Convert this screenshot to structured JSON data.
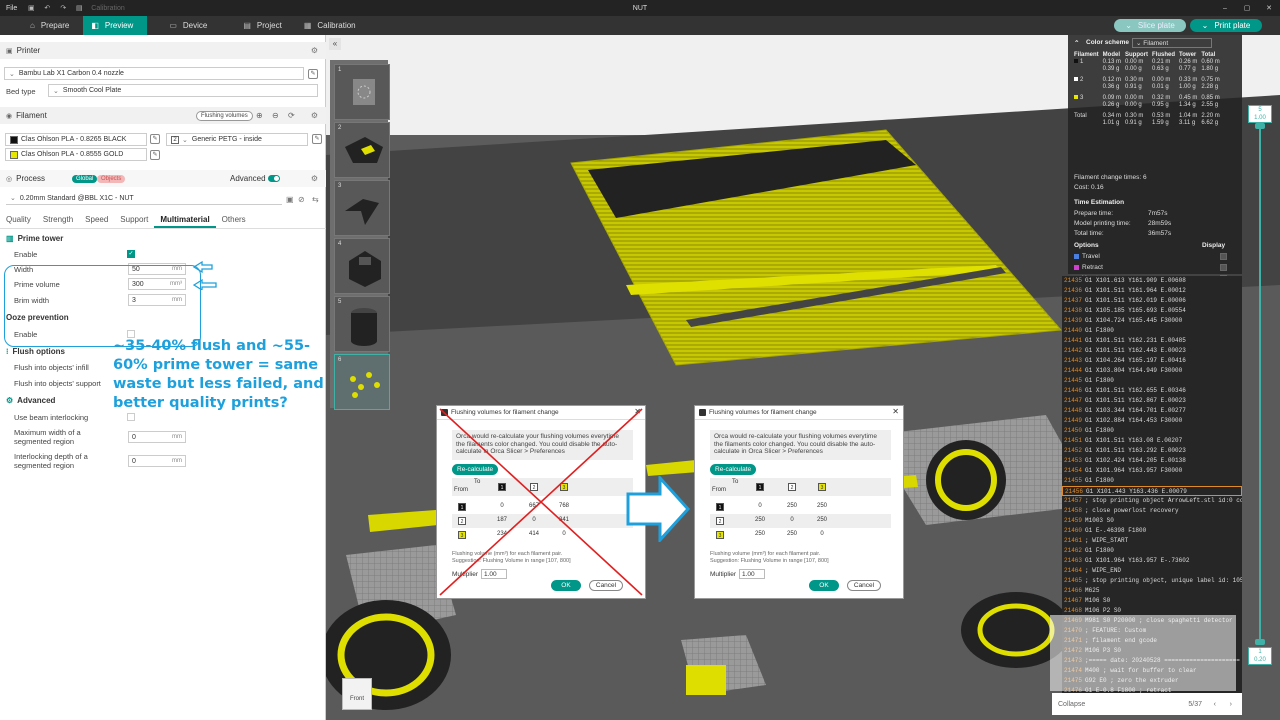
{
  "app": {
    "window_title": "NUT"
  },
  "titlebar": {
    "file": "File",
    "calibration": "Calibration"
  },
  "tabs": [
    {
      "label": "Prepare",
      "icon": "home-icon"
    },
    {
      "label": "Preview",
      "icon": "preview-icon"
    },
    {
      "label": "Device",
      "icon": "device-icon"
    },
    {
      "label": "Project",
      "icon": "project-icon"
    },
    {
      "label": "Calibration",
      "icon": "calibration-icon"
    }
  ],
  "actions": {
    "slice_label": "Slice plate",
    "print_label": "Print plate"
  },
  "printer": {
    "section": "Printer",
    "name": "Bambu Lab X1 Carbon 0.4 nozzle",
    "bed_type_label": "Bed type",
    "bed_type": "Smooth Cool Plate"
  },
  "filament": {
    "section": "Filament",
    "flushing_btn": "Flushing volumes",
    "slots": [
      {
        "num": "1",
        "name": "Clas Ohlson PLA - 0.8265 BLACK",
        "color": "#111111"
      },
      {
        "num": "2",
        "name": "Generic PETG - inside",
        "color": "#ffffff"
      },
      {
        "num": "3",
        "name": "Clas Ohlson PLA - 0.8555 GOLD",
        "color": "#e6e600"
      }
    ]
  },
  "process": {
    "section": "Process",
    "global": "Global",
    "objects": "Objects",
    "advanced": "Advanced",
    "preset": "0.20mm Standard @BBL X1C - NUT",
    "tabs": [
      "Quality",
      "Strength",
      "Speed",
      "Support",
      "Multimaterial",
      "Others"
    ]
  },
  "prime_tower": {
    "title": "Prime tower",
    "enable_label": "Enable",
    "width_label": "Width",
    "width": "50",
    "width_unit": "mm",
    "volume_label": "Prime volume",
    "volume": "300",
    "volume_unit": "mm³",
    "brim_label": "Brim width",
    "brim": "3",
    "brim_unit": "mm"
  },
  "ooze": {
    "title": "Ooze prevention",
    "enable_label": "Enable"
  },
  "flush_opts": {
    "title": "Flush options",
    "infill": "Flush into objects' infill",
    "support": "Flush into objects' support"
  },
  "advanced": {
    "title": "Advanced",
    "beam": "Use beam interlocking",
    "max_w_label": "Maximum width of a segmented region",
    "max_w": "0",
    "max_w_unit": "mm",
    "depth_label": "Interlocking depth of a segmented region",
    "depth": "0",
    "depth_unit": "mm"
  },
  "annotation": "~35-40% flush and ~55-60% prime tower = same waste but less failed, and better quality prints?",
  "objects": [
    {
      "num": "1"
    },
    {
      "num": "2"
    },
    {
      "num": "3"
    },
    {
      "num": "4"
    },
    {
      "num": "5"
    },
    {
      "num": "6"
    }
  ],
  "legend": {
    "color_scheme_label": "Color scheme",
    "color_scheme": "Filament",
    "headers": [
      "Filament",
      "Model",
      "Support",
      "Flushed",
      "Tower",
      "Total"
    ],
    "rows": [
      {
        "id": "1",
        "color": "#111111",
        "model": [
          "0.13 m",
          "0.39 g"
        ],
        "support": [
          "0.00 m",
          "0.00 g"
        ],
        "flushed": [
          "0.21 m",
          "0.63 g"
        ],
        "tower": [
          "0.26 m",
          "0.77 g"
        ],
        "total": [
          "0.60 m",
          "1.80 g"
        ]
      },
      {
        "id": "2",
        "color": "#ffffff",
        "model": [
          "0.12 m",
          "0.36 g"
        ],
        "support": [
          "0.30 m",
          "0.91 g"
        ],
        "flushed": [
          "0.00 m",
          "0.01 g"
        ],
        "tower": [
          "0.33 m",
          "1.00 g"
        ],
        "total": [
          "0.75 m",
          "2.28 g"
        ]
      },
      {
        "id": "3",
        "color": "#e6e600",
        "model": [
          "0.09 m",
          "0.26 g"
        ],
        "support": [
          "0.00 m",
          "0.00 g"
        ],
        "flushed": [
          "0.32 m",
          "0.95 g"
        ],
        "tower": [
          "0.45 m",
          "1.34 g"
        ],
        "total": [
          "0.85 m",
          "2.55 g"
        ]
      },
      {
        "id": "Total",
        "color": "",
        "model": [
          "0.34 m",
          "1.01 g"
        ],
        "support": [
          "0.30 m",
          "0.91 g"
        ],
        "flushed": [
          "0.53 m",
          "1.59 g"
        ],
        "tower": [
          "1.04 m",
          "3.11 g"
        ],
        "total": [
          "2.20 m",
          "6.62 g"
        ]
      }
    ],
    "change_times": "Filament change times:  6",
    "cost": "Cost:  0.16",
    "time_title": "Time Estimation",
    "prepare_label": "Prepare time:",
    "prepare": "7m57s",
    "model_label": "Model printing time:",
    "model": "28m59s",
    "total_label": "Total time:",
    "total": "36m57s",
    "options_label": "Options",
    "display_label": "Display",
    "options": [
      {
        "name": "Travel",
        "color": "#4a7fe0"
      },
      {
        "name": "Retract",
        "color": "#d040d0"
      },
      {
        "name": "Unretract",
        "color": "#3a9fe8"
      },
      {
        "name": "Wipe",
        "color": "#f0e020"
      },
      {
        "name": "Seams",
        "color": "#cccccc"
      }
    ]
  },
  "gcode": [
    {
      "n": "21435",
      "c": "G1 X101.613 Y161.909 E.00608"
    },
    {
      "n": "21436",
      "c": "G1 X101.511 Y161.964 E.00012"
    },
    {
      "n": "21437",
      "c": "G1 X101.511 Y162.019 E.00006"
    },
    {
      "n": "21438",
      "c": "G1 X105.185 Y165.693 E.00554"
    },
    {
      "n": "21439",
      "c": "G1 X104.724 Y165.445 F30000"
    },
    {
      "n": "21440",
      "c": "G1 F1800"
    },
    {
      "n": "21441",
      "c": "G1 X101.511 Y162.231 E.00485"
    },
    {
      "n": "21442",
      "c": "G1 X101.511 Y162.443 E.00023"
    },
    {
      "n": "21443",
      "c": "G1 X104.264 Y165.197 E.00416"
    },
    {
      "n": "21444",
      "c": "G1 X103.804 Y164.949 F30000"
    },
    {
      "n": "21445",
      "c": "G1 F1800"
    },
    {
      "n": "21446",
      "c": "G1 X101.511 Y162.655 E.00346"
    },
    {
      "n": "21447",
      "c": "G1 X101.511 Y162.867 E.00023"
    },
    {
      "n": "21448",
      "c": "G1 X103.344 Y164.701 E.00277"
    },
    {
      "n": "21449",
      "c": "G1 X102.884 Y164.453 F30000"
    },
    {
      "n": "21450",
      "c": "G1 F1800"
    },
    {
      "n": "21451",
      "c": "G1 X101.511 Y163.08 E.00207"
    },
    {
      "n": "21452",
      "c": "G1 X101.511 Y163.292 E.00023"
    },
    {
      "n": "21453",
      "c": "G1 X102.424 Y164.205 E.00138"
    },
    {
      "n": "21454",
      "c": "G1 X101.964 Y163.957 F30000"
    },
    {
      "n": "21455",
      "c": "G1 F1800"
    },
    {
      "n": "21456",
      "c": "G1 X101.443 Y163.436 E.00079",
      "sel": true
    },
    {
      "n": "21457",
      "c": "; stop printing object ArrowLeft.stl id:0 copy 0"
    },
    {
      "n": "21458",
      "c": "; close powerlost recovery"
    },
    {
      "n": "21459",
      "c": "M1003 S0"
    },
    {
      "n": "21460",
      "c": "G1 E-.46398 F1800"
    },
    {
      "n": "21461",
      "c": "; WIPE_START"
    },
    {
      "n": "21462",
      "c": "G1 F1800"
    },
    {
      "n": "21463",
      "c": "G1 X101.964 Y163.957 E-.73602"
    },
    {
      "n": "21464",
      "c": "; WIPE_END"
    },
    {
      "n": "21465",
      "c": "; stop printing object, unique label id: 10590"
    },
    {
      "n": "21466",
      "c": "M625"
    },
    {
      "n": "21467",
      "c": "M106 S0"
    },
    {
      "n": "21468",
      "c": "M106 P2 S0"
    },
    {
      "n": "21469",
      "c": "M981 S0 P20000 ; close spaghetti detector"
    },
    {
      "n": "21470",
      "c": "; FEATURE: Custom"
    },
    {
      "n": "21471",
      "c": "; filament end gcode"
    },
    {
      "n": "21472",
      "c": "M106 P3 S0"
    },
    {
      "n": "21473",
      "c": ";===== date: 20240528 ====================="
    },
    {
      "n": "21474",
      "c": "M400 ; wait for buffer to clear"
    },
    {
      "n": "21475",
      "c": "G92 E0 ; zero the extruder"
    },
    {
      "n": "21476",
      "c": "G1 E-0.8 F1800 ; retract"
    }
  ],
  "gcode_footer": {
    "collapse": "Collapse",
    "page": "5/37"
  },
  "slider": {
    "top_value": "5",
    "top_height": "1.00",
    "bottom_value": "1",
    "bottom_height": "0.20"
  },
  "dialogs": [
    {
      "title": "Flushing volumes for filament change",
      "info": "Orca would re-calculate your flushing volumes everytime the filaments color changed. You could disable the auto-calculate in Orca Slicer > Preferences",
      "recalc": "Re-calculate",
      "to": "To",
      "from": "From",
      "matrix": [
        [
          "0",
          "667",
          "768"
        ],
        [
          "187",
          "0",
          "341"
        ],
        [
          "234",
          "414",
          "0"
        ]
      ],
      "note1": "Flushing volume (mm³) for each filament pair.",
      "note2": "Suggestion: Flushing Volume in range [107, 800]",
      "mult_label": "Multiplier",
      "mult": "1.00",
      "ok": "OK",
      "cancel": "Cancel"
    },
    {
      "title": "Flushing volumes for filament change",
      "info": "Orca would re-calculate your flushing volumes everytime the filaments color changed. You could disable the auto-calculate in Orca Slicer > Preferences",
      "recalc": "Re-calculate",
      "to": "To",
      "from": "From",
      "matrix": [
        [
          "0",
          "250",
          "250"
        ],
        [
          "250",
          "0",
          "250"
        ],
        [
          "250",
          "250",
          "0"
        ]
      ],
      "note1": "Flushing volume (mm³) for each filament pair.",
      "note2": "Suggestion: Flushing Volume in range [107, 800]",
      "mult_label": "Multiplier",
      "mult": "1.00",
      "ok": "OK",
      "cancel": "Cancel"
    }
  ],
  "view_cube": {
    "front": "Front"
  },
  "colors": {
    "accent": "#009688",
    "annotation": "#1ea0dc",
    "filament_gold": "#e6e600"
  }
}
